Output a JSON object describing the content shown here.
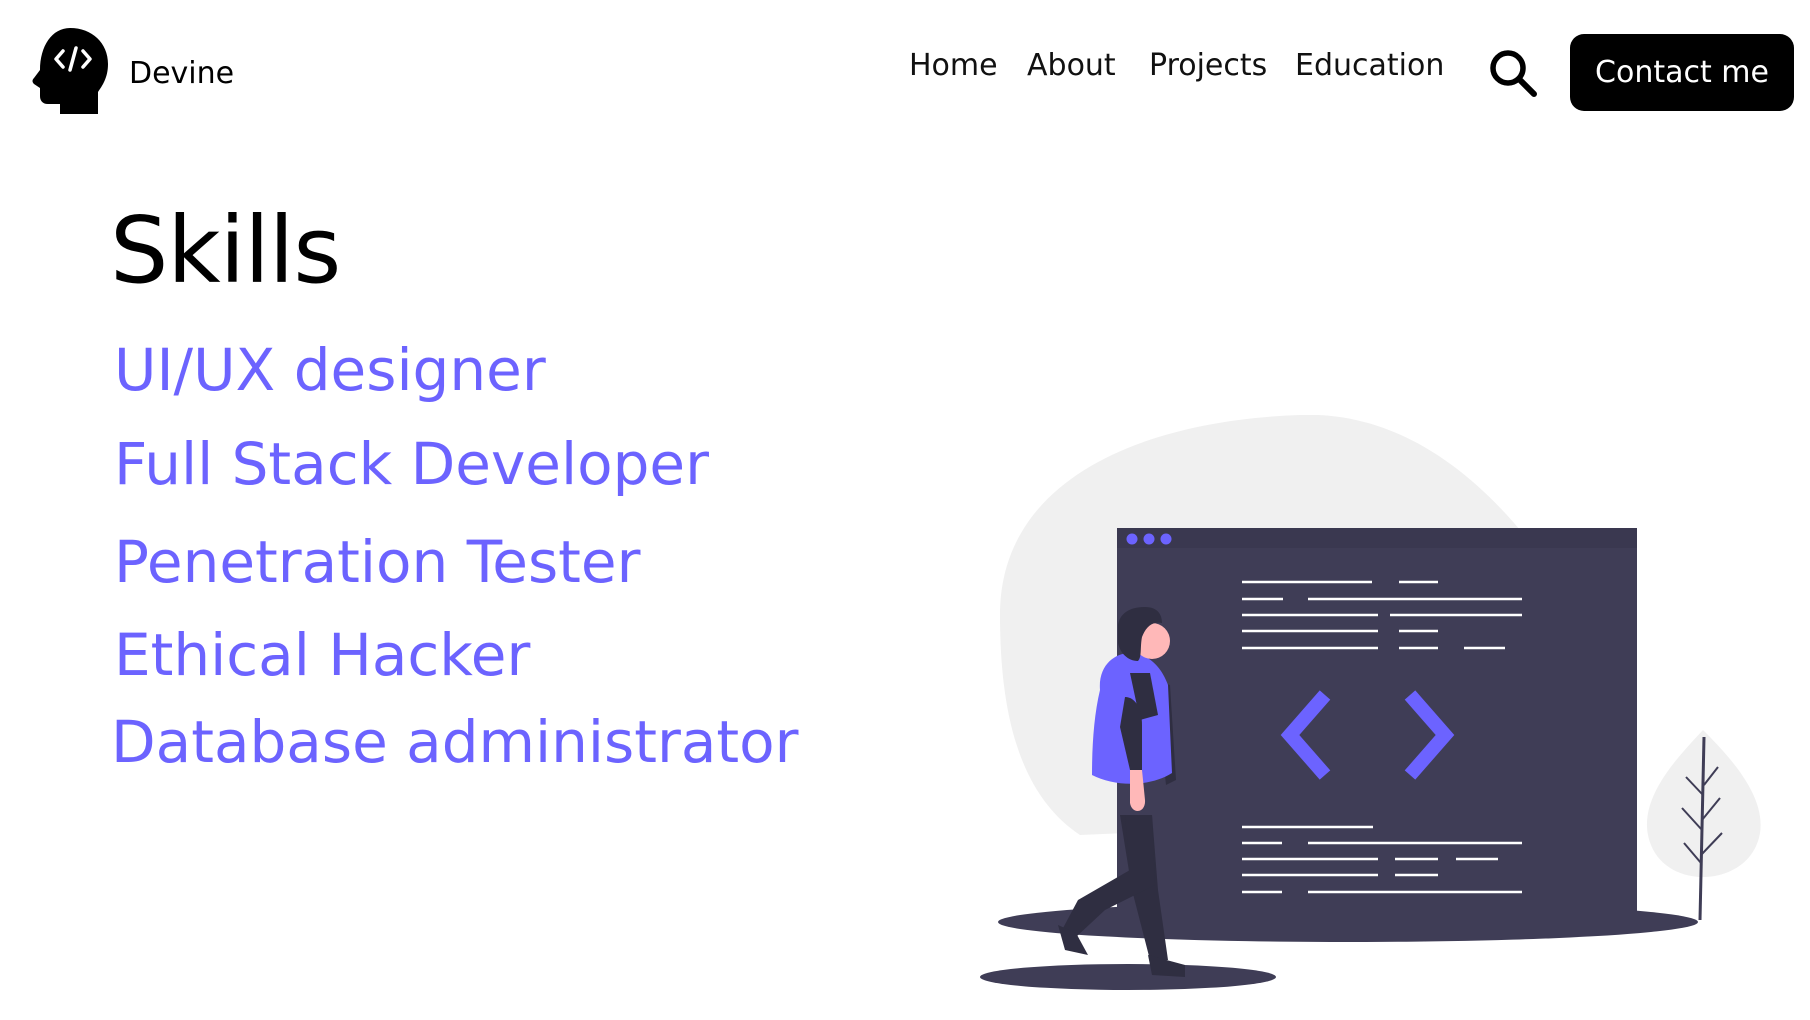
{
  "brand": {
    "name": "Devine",
    "logo_icon": "head-code-icon"
  },
  "nav": {
    "items": [
      {
        "label": "Home"
      },
      {
        "label": "About"
      },
      {
        "label": "Projects"
      },
      {
        "label": "Education"
      }
    ],
    "search_icon": "search-icon",
    "contact_label": "Contact me"
  },
  "skills": {
    "title": "Skills",
    "items": [
      "UI/UX designer",
      "Full Stack Developer",
      "Penetration Tester",
      "Ethical Hacker",
      "Database administrator"
    ]
  },
  "illustration": {
    "window_icon": "code-brackets-icon",
    "person_icon": "person-walking-icon",
    "plant_icon": "plant-icon"
  },
  "colors": {
    "accent": "#6c63ff",
    "text": "#000000",
    "screen": "#3f3d56",
    "blob": "#f0f0f0",
    "button_bg": "#000000",
    "button_text": "#ffffff"
  }
}
